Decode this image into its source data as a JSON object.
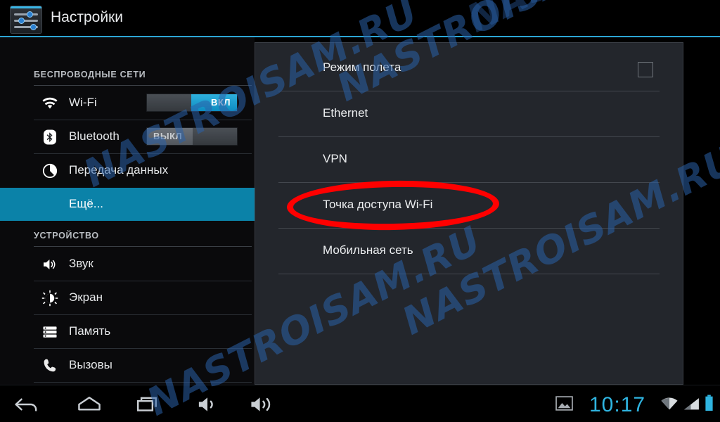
{
  "header": {
    "title": "Настройки",
    "icon": "settings-sliders-icon"
  },
  "sidebar": {
    "sections": [
      {
        "title": "БЕСПРОВОДНЫЕ СЕТИ",
        "items": [
          {
            "label": "Wi-Fi",
            "icon": "wifi-icon",
            "toggle": {
              "state": "on",
              "label": "ВКЛ"
            }
          },
          {
            "label": "Bluetooth",
            "icon": "bluetooth-icon",
            "toggle": {
              "state": "off",
              "label": "ВЫКЛ"
            }
          },
          {
            "label": "Передача данных",
            "icon": "data-usage-pie-icon",
            "toggle": null
          },
          {
            "label": "Ещё...",
            "icon": null,
            "toggle": null,
            "selected": true
          }
        ]
      },
      {
        "title": "УСТРОЙСТВО",
        "items": [
          {
            "label": "Звук",
            "icon": "speaker-icon",
            "toggle": null
          },
          {
            "label": "Экран",
            "icon": "brightness-icon",
            "toggle": null
          },
          {
            "label": "Память",
            "icon": "storage-icon",
            "toggle": null
          },
          {
            "label": "Вызовы",
            "icon": "phone-icon",
            "toggle": null
          }
        ]
      }
    ]
  },
  "panel": {
    "items": [
      {
        "label": "Режим полета",
        "control": "checkbox",
        "checked": false
      },
      {
        "label": "Ethernet",
        "control": null
      },
      {
        "label": "VPN",
        "control": null
      },
      {
        "label": "Точка доступа Wi-Fi",
        "control": null,
        "highlighted": true
      },
      {
        "label": "Мобильная сеть",
        "control": null
      }
    ]
  },
  "navbar": {
    "buttons": [
      {
        "name": "back-icon"
      },
      {
        "name": "home-icon"
      },
      {
        "name": "recents-icon"
      },
      {
        "name": "volume-down-icon"
      },
      {
        "name": "volume-up-icon"
      }
    ],
    "status": {
      "screenshot_icon": "image-icon",
      "time": "10:17",
      "wifi_icon": "wifi-signal-icon",
      "cellular_icon": "cellular-signal-icon",
      "battery_icon": "battery-full-icon"
    }
  },
  "watermark": {
    "text": "NASTROISAM.RU"
  },
  "colors": {
    "accent": "#2fb4e0",
    "selection": "#0b82a8",
    "annotation": "#ff0000",
    "panel_bg": "#23262c",
    "sidebar_bg": "#0a0a0c"
  }
}
